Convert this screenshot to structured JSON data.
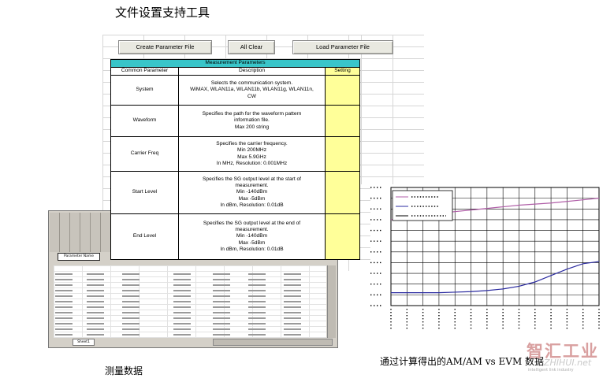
{
  "page": {
    "title": "文件设置支持工具",
    "caption_left": "测量数据",
    "caption_right": "通过计算得出的AM/AM vs EVM 数据",
    "watermark_cn": "智汇工业",
    "watermark_en": "ZHIHUI.net",
    "watermark_tag": "intelligent link industry"
  },
  "toolbar": {
    "create_label": "Create Parameter File",
    "clear_label": "All Clear",
    "load_label": "Load Parameter File"
  },
  "params_table": {
    "title": "Measurement Parameters",
    "headers": [
      "Common Parameter",
      "Description",
      "Setting"
    ],
    "rows": [
      {
        "name": "System",
        "desc": [
          "Selects the communication system.",
          "WiMAX, WLAN11a, WLAN11b, WLAN11g, WLAN11n,",
          "CW"
        ],
        "setting": ""
      },
      {
        "name": "Waveform",
        "desc": [
          "Specifies the path for the waveform pattern",
          "information file.",
          "Max 200 string"
        ],
        "setting": ""
      },
      {
        "name": "Carrier Freq",
        "desc": [
          "Specifies the carrier frequency.",
          "Min 200MHz",
          "Max 5.9GHz",
          "In MHz,  Resolution: 0.001MHz"
        ],
        "setting": ""
      },
      {
        "name": "Start Level",
        "desc": [
          "Specifies the SG output level at the start of",
          "measurement.",
          "Min -140dBm",
          "Max -5dBm",
          "In dBm, Resolution: 0.01dB"
        ],
        "setting": ""
      },
      {
        "name": "End Level",
        "desc": [
          "Specifies the SG output level at the end of",
          "measurement.",
          "Min -140dBm",
          "Max -5dBm",
          "In dBm, Resolution: 0.01dB"
        ],
        "setting": ""
      }
    ]
  },
  "thumbnail": {
    "tab_label": "Sheet1",
    "header_label": "Parameter Name"
  },
  "chart_data": {
    "type": "line",
    "title": "",
    "xlabel": "",
    "ylabel": "",
    "grid": true,
    "legend": "top-left",
    "series": [
      {
        "name": "",
        "color": "#b05fa8",
        "x": [
          0,
          1,
          2,
          3,
          4,
          5,
          6,
          7,
          8,
          9,
          10,
          11,
          12,
          13
        ],
        "values": [
          8.0,
          8.2,
          8.4,
          8.6,
          8.75,
          8.9,
          9.05,
          9.2,
          9.35,
          9.45,
          9.55,
          9.7,
          9.85,
          10.0
        ]
      },
      {
        "name": "",
        "color": "#2b2ba0",
        "x": [
          0,
          1,
          2,
          3,
          4,
          5,
          6,
          7,
          8,
          9,
          10,
          11,
          12,
          13
        ],
        "values": [
          1.2,
          1.2,
          1.2,
          1.2,
          1.25,
          1.3,
          1.4,
          1.55,
          1.8,
          2.2,
          2.8,
          3.4,
          3.9,
          4.1
        ]
      }
    ],
    "ylim": [
      0,
      11
    ],
    "xlim": [
      0,
      13
    ]
  }
}
